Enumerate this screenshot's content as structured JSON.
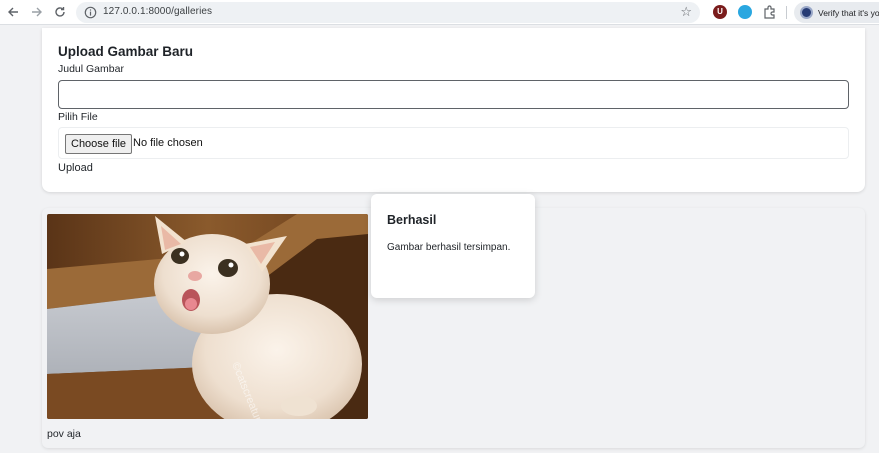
{
  "browser": {
    "url": "127.0.0.1:8000/galleries",
    "extension_u_label": "U",
    "profile_chip_text": "Verify that it's you",
    "icons": [
      "back-arrow-icon",
      "forward-arrow-icon",
      "reload-icon",
      "site-info-icon",
      "bookmark-star-icon",
      "puzzle-extensions-icon"
    ]
  },
  "upload_form": {
    "title": "Upload Gambar Baru",
    "judul_label": "Judul Gambar",
    "judul_value": "",
    "file_label": "Pilih File",
    "choose_file_button": "Choose file",
    "no_file_text": "No file chosen",
    "submit_label": "Upload"
  },
  "gallery": {
    "items": [
      {
        "caption": "pov aja"
      }
    ]
  },
  "toast": {
    "title": "Berhasil",
    "message": "Gambar berhasil tersimpan."
  },
  "colors": {
    "page_background": "#f1f2f4",
    "card_background": "#ffffff",
    "text": "#1f2328"
  }
}
